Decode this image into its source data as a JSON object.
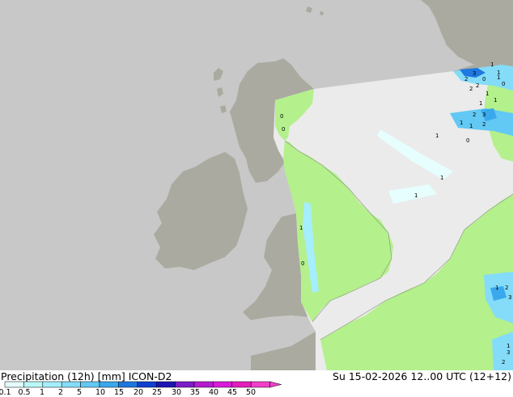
{
  "footer": {
    "title": "Precipitation (12h) [mm] ICON-D2",
    "datetime": "Su 15-02-2026 12..00 UTC (12+12)"
  },
  "legend": {
    "ticks": [
      "0.1",
      "0.5",
      "1",
      "2",
      "5",
      "10",
      "15",
      "20",
      "25",
      "30",
      "35",
      "40",
      "45",
      "50"
    ],
    "colors": [
      "#e6fefe",
      "#b9f8f8",
      "#a4eefe",
      "#84dcf8",
      "#62c8f4",
      "#3aa8ec",
      "#1e78e0",
      "#1040d0",
      "#1c14b4",
      "#7a1cc8",
      "#b41cd0",
      "#d81cd8",
      "#e41cbc",
      "#f040c8"
    ]
  },
  "map": {
    "sea_color": "#c8c8c8",
    "outside_land_color": "#aaaaa0",
    "domain_sea_color": "#ebebeb",
    "domain_land_color": "#b4f08c",
    "precip_values": [
      "1",
      "2",
      "3",
      "0",
      "1",
      "2",
      "1",
      "0",
      "1",
      "2",
      "3",
      "1",
      "1",
      "2",
      "0",
      "1",
      "1",
      "0",
      "0",
      "1",
      "2",
      "3",
      "1",
      "1",
      "1",
      "2",
      "1",
      "3",
      "2",
      "1",
      "0"
    ]
  }
}
